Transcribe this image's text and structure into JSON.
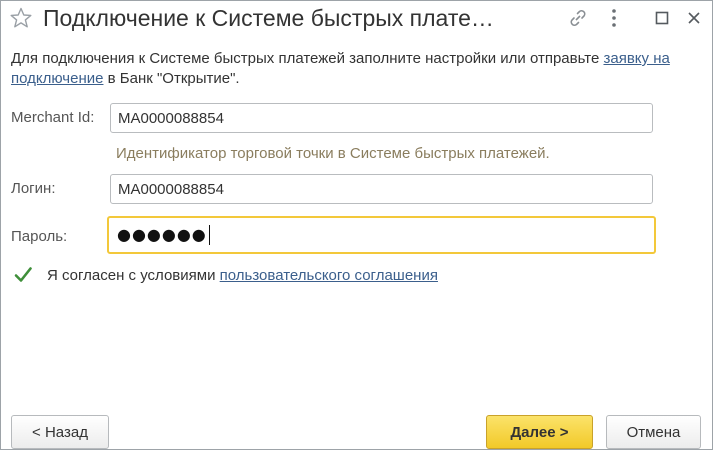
{
  "window": {
    "title": "Подключение к Системе быстрых плате…"
  },
  "intro": {
    "before_link": "Для подключения к Системе быстрых платежей заполните настройки или отправьте ",
    "link_text": "заявку на подключение",
    "after_link": " в Банк \"Открытие\"."
  },
  "form": {
    "merchant_label": "Merchant Id:",
    "merchant_value": "MA0000088854",
    "merchant_hint": "Идентификатор торговой точки в Системе быстрых платежей.",
    "login_label": "Логин:",
    "login_value": "MA0000088854",
    "password_label": "Пароль:",
    "password_mask": "●●●●●●"
  },
  "agreement": {
    "checked": true,
    "text": "Я согласен с условиями ",
    "link_text": "пользовательского соглашения"
  },
  "buttons": {
    "back": "< Назад",
    "next": "Далее >",
    "cancel": "Отмена"
  },
  "colors": {
    "accent_yellow": "#f2c928",
    "focus_border": "#f3c83a",
    "link": "#3b5f8c",
    "check_green": "#3f8f3a",
    "hint_text": "#8a7d5e"
  },
  "icons": {
    "title_star": "star-icon",
    "title_link": "link-icon",
    "title_more": "more-vertical-icon",
    "title_max": "maximize-icon",
    "title_close": "close-icon",
    "agree_check": "checkmark-icon"
  }
}
